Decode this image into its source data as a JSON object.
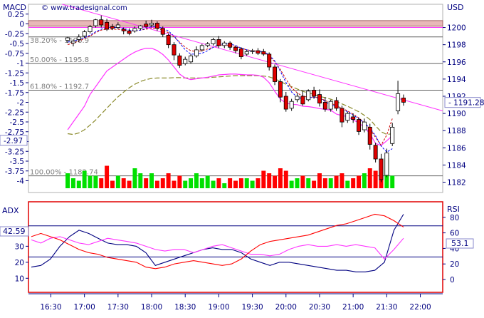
{
  "header": {
    "left_label": "MACD",
    "watermark": "© www.tradesignal.com",
    "right_label": "USD"
  },
  "lower_panel": {
    "left_label": "ADX",
    "right_label": "RSI",
    "adx_value": "42.59",
    "rsi_value": "53.1"
  },
  "colors": {
    "bull_candle": "#ffffff",
    "bear_candle": "#e00000",
    "volume_up": "#00e000",
    "volume_down": "#ff0000",
    "trendline": "#ff33ff",
    "resistance_band": "#e8b8b8",
    "hline": "#606060",
    "macd_line": "#ff33ff",
    "macd_signal": "#8a8a2a",
    "ma_fast": "#0000ff",
    "ma_slow": "#cc0000",
    "adx": "#000080",
    "plus_di": "#ff33ff",
    "minus_di": "#ff0000",
    "lower_border": "#e00000"
  },
  "chart_data": [
    {
      "type": "candlestick",
      "ylabel": "USD",
      "ylim": [
        1180.8,
        1202.7
      ],
      "y_ticks": [
        1182,
        1184,
        1186,
        1188,
        1190,
        1192,
        1194,
        1196,
        1198,
        1200
      ],
      "secondary_axis": {
        "label": "MACD",
        "ylim": [
          -4.3,
          0.5
        ],
        "ticks": [
          "0.25",
          "0",
          "-0.25",
          "-0.5",
          "-0.75",
          "-1",
          "-1.25",
          "-1.5",
          "-1.75",
          "-2",
          "-2.25",
          "-2.5",
          "-2.75",
          "-3",
          "-3.25",
          "-3.5",
          "-3.75",
          "-4"
        ],
        "current_value": "-2.97"
      },
      "x_ticks": [
        "16:30",
        "17:00",
        "17:30",
        "18:00",
        "18:30",
        "19:00",
        "19:30",
        "20:00",
        "20:30",
        "21:00",
        "21:30",
        "22:00"
      ],
      "last_price": "1191.28",
      "fib_levels": [
        {
          "label": "38.20% - 1198.9",
          "value": 1198.9
        },
        {
          "label": "50.00% - 1195.8",
          "value": 1195.8
        },
        {
          "label": "61.80% - 1192.7",
          "value": 1192.7
        },
        {
          "label": "100.00% - 1182.74",
          "value": 1182.74
        }
      ],
      "resistance_zone": [
        1200.15,
        1200.8
      ],
      "resistance_line": 1200.0,
      "trendline": [
        {
          "t": "16:40",
          "price": 1202.7
        },
        {
          "t": "22:20",
          "price": 1190.3
        }
      ],
      "candles": [
        {
          "t": "16:45",
          "o": 1198.5,
          "h": 1198.9,
          "c": 1198.8,
          "l": 1198.2
        },
        {
          "t": "16:50",
          "o": 1198.2,
          "h": 1198.6,
          "c": 1198.4,
          "l": 1197.8
        },
        {
          "t": "16:55",
          "o": 1198.6,
          "h": 1199.2,
          "c": 1198.9,
          "l": 1198.3
        },
        {
          "t": "17:00",
          "o": 1199.0,
          "h": 1199.7,
          "c": 1199.5,
          "l": 1198.8
        },
        {
          "t": "17:05",
          "o": 1199.5,
          "h": 1200.3,
          "c": 1200.1,
          "l": 1199.3
        },
        {
          "t": "17:10",
          "o": 1200.2,
          "h": 1201.0,
          "c": 1200.9,
          "l": 1200.0
        },
        {
          "t": "17:15",
          "o": 1200.9,
          "h": 1201.4,
          "c": 1200.3,
          "l": 1200.0
        },
        {
          "t": "17:20",
          "o": 1200.6,
          "h": 1201.0,
          "c": 1199.8,
          "l": 1199.6
        },
        {
          "t": "17:25",
          "o": 1200.1,
          "h": 1200.4,
          "c": 1199.9,
          "l": 1199.7
        },
        {
          "t": "17:30",
          "o": 1200.0,
          "h": 1200.6,
          "c": 1200.3,
          "l": 1199.8
        },
        {
          "t": "17:35",
          "o": 1199.8,
          "h": 1200.0,
          "c": 1199.6,
          "l": 1199.2
        },
        {
          "t": "17:40",
          "o": 1199.6,
          "h": 1199.9,
          "c": 1199.3,
          "l": 1199.1
        },
        {
          "t": "17:45",
          "o": 1199.6,
          "h": 1200.1,
          "c": 1199.9,
          "l": 1199.4
        },
        {
          "t": "17:50",
          "o": 1199.9,
          "h": 1200.3,
          "c": 1200.2,
          "l": 1199.7
        },
        {
          "t": "17:55",
          "o": 1200.4,
          "h": 1200.8,
          "c": 1200.1,
          "l": 1199.9
        },
        {
          "t": "18:00",
          "o": 1200.3,
          "h": 1200.9,
          "c": 1200.5,
          "l": 1200.0
        },
        {
          "t": "18:05",
          "o": 1200.5,
          "h": 1200.7,
          "c": 1199.9,
          "l": 1199.6
        },
        {
          "t": "18:10",
          "o": 1199.9,
          "h": 1200.1,
          "c": 1199.2,
          "l": 1198.9
        },
        {
          "t": "18:15",
          "o": 1199.1,
          "h": 1199.3,
          "c": 1198.0,
          "l": 1197.6
        },
        {
          "t": "18:20",
          "o": 1198.0,
          "h": 1198.3,
          "c": 1196.8,
          "l": 1196.2
        },
        {
          "t": "18:25",
          "o": 1196.7,
          "h": 1197.0,
          "c": 1195.6,
          "l": 1195.3
        },
        {
          "t": "18:30",
          "o": 1195.8,
          "h": 1196.6,
          "c": 1196.3,
          "l": 1195.6
        },
        {
          "t": "18:35",
          "o": 1196.0,
          "h": 1196.9,
          "c": 1196.7,
          "l": 1195.8
        },
        {
          "t": "18:40",
          "o": 1196.7,
          "h": 1197.8,
          "c": 1197.4,
          "l": 1196.5
        },
        {
          "t": "18:45",
          "o": 1197.4,
          "h": 1198.1,
          "c": 1197.9,
          "l": 1197.2
        },
        {
          "t": "18:50",
          "o": 1197.9,
          "h": 1198.3,
          "c": 1198.1,
          "l": 1197.7
        },
        {
          "t": "18:55",
          "o": 1198.1,
          "h": 1198.8,
          "c": 1198.6,
          "l": 1197.9
        },
        {
          "t": "19:00",
          "o": 1198.6,
          "h": 1199.0,
          "c": 1197.9,
          "l": 1197.6
        },
        {
          "t": "19:05",
          "o": 1197.9,
          "h": 1198.4,
          "c": 1198.2,
          "l": 1197.6
        },
        {
          "t": "19:10",
          "o": 1198.2,
          "h": 1198.4,
          "c": 1197.7,
          "l": 1197.4
        },
        {
          "t": "19:15",
          "o": 1197.7,
          "h": 1197.9,
          "c": 1197.3,
          "l": 1197.0
        },
        {
          "t": "19:20",
          "o": 1197.5,
          "h": 1197.7,
          "c": 1196.6,
          "l": 1196.3
        },
        {
          "t": "19:25",
          "o": 1196.9,
          "h": 1197.4,
          "c": 1197.2,
          "l": 1196.7
        },
        {
          "t": "19:30",
          "o": 1197.2,
          "h": 1197.5,
          "c": 1197.3,
          "l": 1196.9
        },
        {
          "t": "19:35",
          "o": 1197.3,
          "h": 1197.6,
          "c": 1197.0,
          "l": 1196.8
        },
        {
          "t": "19:40",
          "o": 1197.2,
          "h": 1197.5,
          "c": 1196.9,
          "l": 1196.7
        },
        {
          "t": "19:45",
          "o": 1196.9,
          "h": 1197.1,
          "c": 1195.4,
          "l": 1195.0
        },
        {
          "t": "19:50",
          "o": 1195.4,
          "h": 1195.7,
          "c": 1193.7,
          "l": 1193.3
        },
        {
          "t": "19:55",
          "o": 1193.7,
          "h": 1194.0,
          "c": 1191.9,
          "l": 1191.3
        },
        {
          "t": "20:00",
          "o": 1192.0,
          "h": 1192.5,
          "c": 1190.5,
          "l": 1190.2
        },
        {
          "t": "20:05",
          "o": 1190.6,
          "h": 1191.7,
          "c": 1191.4,
          "l": 1190.3
        },
        {
          "t": "20:10",
          "o": 1191.6,
          "h": 1192.4,
          "c": 1192.0,
          "l": 1191.3
        },
        {
          "t": "20:15",
          "o": 1192.0,
          "h": 1192.6,
          "c": 1191.1,
          "l": 1190.9
        },
        {
          "t": "20:20",
          "o": 1191.6,
          "h": 1192.8,
          "c": 1192.6,
          "l": 1191.4
        },
        {
          "t": "20:25",
          "o": 1192.7,
          "h": 1193.1,
          "c": 1192.0,
          "l": 1191.7
        },
        {
          "t": "20:30",
          "o": 1192.2,
          "h": 1192.8,
          "c": 1191.2,
          "l": 1190.8
        },
        {
          "t": "20:35",
          "o": 1191.3,
          "h": 1191.9,
          "c": 1190.5,
          "l": 1190.2
        },
        {
          "t": "20:40",
          "o": 1190.5,
          "h": 1191.6,
          "c": 1191.4,
          "l": 1190.2
        },
        {
          "t": "20:45",
          "o": 1191.5,
          "h": 1191.9,
          "c": 1190.6,
          "l": 1190.3
        },
        {
          "t": "20:50",
          "o": 1190.6,
          "h": 1190.9,
          "c": 1189.0,
          "l": 1188.4
        },
        {
          "t": "20:55",
          "o": 1189.2,
          "h": 1190.2,
          "c": 1190.0,
          "l": 1188.9
        },
        {
          "t": "21:00",
          "o": 1189.6,
          "h": 1190.0,
          "c": 1189.3,
          "l": 1188.9
        },
        {
          "t": "21:05",
          "o": 1189.3,
          "h": 1189.5,
          "c": 1187.9,
          "l": 1187.5
        },
        {
          "t": "21:10",
          "o": 1188.1,
          "h": 1189.4,
          "c": 1189.0,
          "l": 1187.8
        },
        {
          "t": "21:15",
          "o": 1188.4,
          "h": 1188.8,
          "c": 1186.4,
          "l": 1185.8
        },
        {
          "t": "21:20",
          "o": 1186.3,
          "h": 1186.6,
          "c": 1184.7,
          "l": 1184.3
        },
        {
          "t": "21:25",
          "o": 1184.7,
          "h": 1185.3,
          "c": 1182.3,
          "l": 1182.0
        },
        {
          "t": "21:30",
          "o": 1182.8,
          "h": 1185.9,
          "c": 1185.4,
          "l": 1182.6
        },
        {
          "t": "21:35",
          "o": 1186.5,
          "h": 1188.9,
          "c": 1188.4,
          "l": 1186.2
        },
        {
          "t": "21:40",
          "o": 1190.3,
          "h": 1193.8,
          "c": 1192.3,
          "l": 1189.9
        },
        {
          "t": "21:45",
          "o": 1191.8,
          "h": 1192.2,
          "c": 1191.3,
          "l": 1190.9
        }
      ],
      "volume": [
        6,
        4,
        3,
        7,
        5,
        5,
        4,
        9,
        3,
        5,
        4,
        3,
        8,
        6,
        4,
        6,
        3,
        4,
        6,
        3,
        5,
        3,
        4,
        6,
        4,
        5,
        3,
        4,
        2,
        4,
        3,
        4,
        4,
        3,
        4,
        7,
        6,
        5,
        8,
        7,
        3,
        4,
        5,
        4,
        3,
        6,
        4,
        4,
        5,
        6,
        3,
        4,
        5,
        6,
        8,
        7,
        9,
        12,
        5
      ],
      "macd_line": [
        -2.7,
        -2.5,
        -2.3,
        -2.1,
        -1.8,
        -1.6,
        -1.4,
        -1.2,
        -1.1,
        -1.0,
        -0.9,
        -0.8,
        -0.72,
        -0.66,
        -0.62,
        -0.62,
        -0.68,
        -0.78,
        -0.92,
        -1.1,
        -1.28,
        -1.38,
        -1.42,
        -1.4,
        -1.38,
        -1.36,
        -1.33,
        -1.3,
        -1.29,
        -1.28,
        -1.28,
        -1.29,
        -1.3,
        -1.3,
        -1.31,
        -1.36,
        -1.5,
        -1.72,
        -1.92,
        -2.02,
        -2.05,
        -2.06,
        -2.1,
        -2.11,
        -2.13,
        -2.16,
        -2.18,
        -2.2,
        -2.3,
        -2.34,
        -2.36,
        -2.45,
        -2.52,
        -2.64,
        -2.8,
        -3.05,
        -3.1,
        -2.98,
        -2.85
      ],
      "macd_signal": [
        -2.8,
        -2.82,
        -2.78,
        -2.7,
        -2.58,
        -2.45,
        -2.3,
        -2.15,
        -2.0,
        -1.86,
        -1.74,
        -1.63,
        -1.54,
        -1.47,
        -1.42,
        -1.39,
        -1.38,
        -1.38,
        -1.38,
        -1.37,
        -1.37,
        -1.38,
        -1.38,
        -1.38,
        -1.38,
        -1.37,
        -1.36,
        -1.35,
        -1.34,
        -1.33,
        -1.32,
        -1.32,
        -1.32,
        -1.32,
        -1.32,
        -1.33,
        -1.35,
        -1.4,
        -1.47,
        -1.54,
        -1.6,
        -1.66,
        -1.72,
        -1.76,
        -1.8,
        -1.85,
        -1.88,
        -1.92,
        -1.98,
        -2.04,
        -2.1,
        -2.17,
        -2.24,
        -2.33,
        -2.44,
        -2.6,
        -2.75,
        -2.82,
        -2.8
      ],
      "ma_fast": [
        1198.3,
        1198.4,
        1198.6,
        1198.8,
        1199.1,
        1199.5,
        1199.8,
        1200.0,
        1200.0,
        1200.0,
        1199.9,
        1199.7,
        1199.6,
        1199.7,
        1199.9,
        1200.1,
        1200.1,
        1199.9,
        1199.6,
        1199.0,
        1198.2,
        1197.4,
        1196.9,
        1196.9,
        1197.0,
        1197.3,
        1197.7,
        1198.0,
        1198.1,
        1198.1,
        1197.9,
        1197.6,
        1197.4,
        1197.2,
        1197.2,
        1197.2,
        1196.8,
        1196.1,
        1194.9,
        1193.6,
        1192.5,
        1191.9,
        1191.7,
        1191.8,
        1191.9,
        1191.8,
        1191.4,
        1191.0,
        1190.8,
        1190.5,
        1190.2,
        1189.8,
        1189.4,
        1188.9,
        1188.3,
        1187.4,
        1186.2,
        1185.5,
        1185.9
      ],
      "ma_slow": [
        1198.0,
        1198.2,
        1198.4,
        1198.7,
        1199.0,
        1199.4,
        1199.7,
        1199.8,
        1199.8,
        1199.8,
        1199.7,
        1199.6,
        1199.6,
        1199.7,
        1199.8,
        1199.9,
        1199.9,
        1199.7,
        1199.4,
        1198.9,
        1198.3,
        1197.7,
        1197.3,
        1197.2,
        1197.3,
        1197.5,
        1197.7,
        1197.9,
        1198.0,
        1197.9,
        1197.8,
        1197.6,
        1197.4,
        1197.3,
        1197.2,
        1197.1,
        1196.7,
        1196.0,
        1195.1,
        1194.0,
        1193.0,
        1192.4,
        1192.0,
        1191.9,
        1191.9,
        1191.8,
        1191.5,
        1191.2,
        1190.9,
        1190.6,
        1190.3,
        1189.9,
        1189.5,
        1188.9,
        1188.2,
        1187.2,
        1186.3,
        1187.5,
        1189.4
      ]
    },
    {
      "type": "line",
      "y_ticks_left": [
        10,
        20,
        30,
        40
      ],
      "y_ticks_right": [
        0,
        20,
        40,
        60,
        80
      ],
      "ylim": [
        3,
        56
      ],
      "hlines": [
        29,
        69
      ],
      "hline_axis": "RSI",
      "series": [
        {
          "key": "adx",
          "values": [
            17,
            18,
            22,
            30,
            36,
            40,
            38,
            35,
            32,
            31,
            31,
            30,
            26,
            18,
            20,
            22,
            24,
            26,
            28,
            29,
            28,
            28,
            26,
            22,
            20,
            18,
            20,
            20,
            19,
            18,
            17,
            16,
            15,
            15,
            14,
            14,
            15,
            20,
            40,
            50
          ]
        },
        {
          "key": "plus_di",
          "values": [
            34,
            32,
            35,
            36,
            34,
            32,
            31,
            33,
            35,
            34,
            33,
            32,
            30,
            28,
            27,
            28,
            28,
            26,
            28,
            30,
            31,
            29,
            27,
            25,
            25,
            24,
            25,
            28,
            30,
            31,
            30,
            30,
            31,
            30,
            31,
            30,
            29,
            22,
            28,
            35
          ]
        },
        {
          "key": "minus_di",
          "values": [
            36,
            38,
            36,
            34,
            31,
            28,
            26,
            25,
            23,
            22,
            21,
            20,
            17,
            16,
            17,
            19,
            20,
            21,
            20,
            19,
            18,
            19,
            22,
            27,
            31,
            33,
            34,
            35,
            36,
            37,
            39,
            41,
            43,
            44,
            46,
            48,
            50,
            49,
            46,
            42
          ]
        }
      ]
    }
  ]
}
